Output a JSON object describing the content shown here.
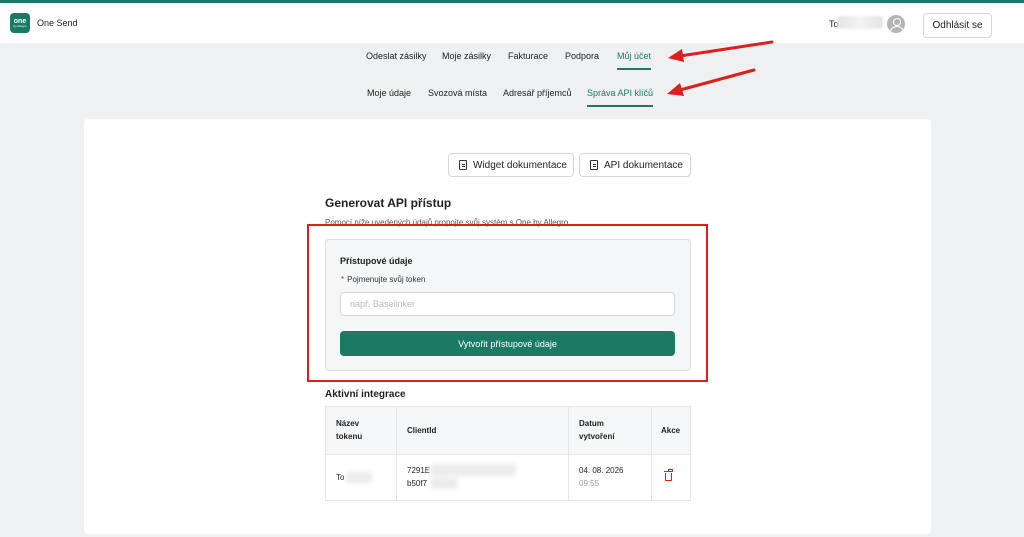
{
  "header": {
    "logo_text": "one",
    "logo_subtext": "by Allegro",
    "app_name": "One Send",
    "user_name": "To",
    "logout_label": "Odhlásit se"
  },
  "main_nav": [
    {
      "label": "Odeslat zásilky"
    },
    {
      "label": "Moje zásilky"
    },
    {
      "label": "Fakturace"
    },
    {
      "label": "Podpora"
    },
    {
      "label": "Můj účet"
    }
  ],
  "sub_nav": [
    {
      "label": "Moje údaje"
    },
    {
      "label": "Svozová místa"
    },
    {
      "label": "Adresář příjemců"
    },
    {
      "label": "Správa API klíčů"
    }
  ],
  "doc_buttons": {
    "widget": "Widget dokumentace",
    "api": "API dokumentace"
  },
  "section": {
    "title": "Generovat API přístup",
    "subtitle": "Pomocí níže uvedených údajů propojte svůj systém s One by Allegro"
  },
  "form": {
    "title": "Přístupové údaje",
    "token_label": "Pojmenujte svůj token",
    "token_placeholder": "např. Baselinker",
    "token_value": "",
    "submit_label": "Vytvořit přístupové údaje"
  },
  "integrations": {
    "title": "Aktivní integrace",
    "columns": [
      "Název tokenu",
      "ClientId",
      "Datum vytvoření",
      "Akce"
    ],
    "rows": [
      {
        "token_name": "To",
        "client_id_line1": "7291E",
        "client_id_line2": "b50f7",
        "date": "04. 08. 2026",
        "time": "09:55"
      }
    ]
  },
  "colors": {
    "accent": "#1b7a64",
    "annotation_red": "#e01e1e"
  }
}
